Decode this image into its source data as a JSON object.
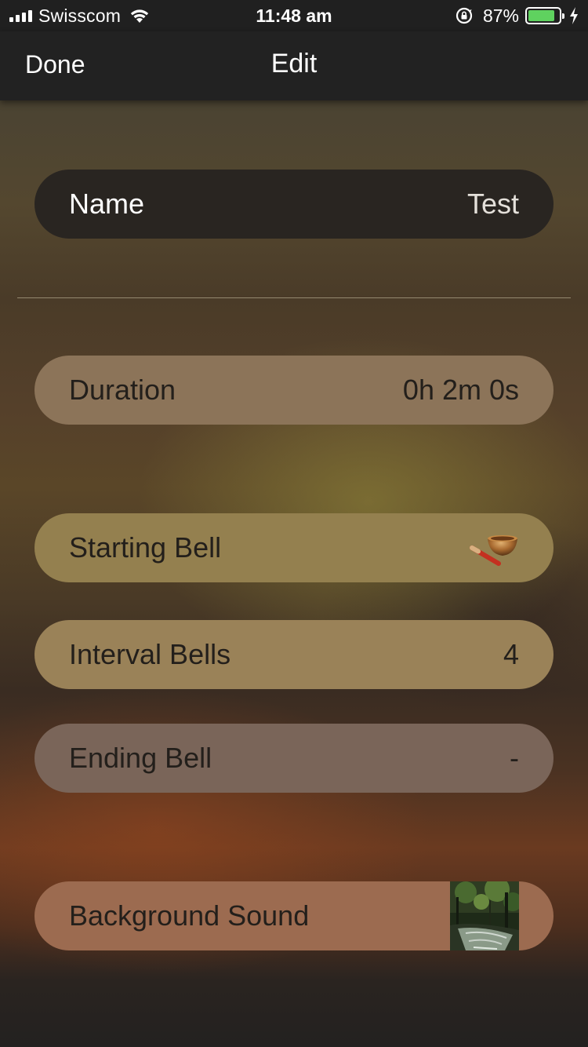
{
  "status_bar": {
    "carrier": "Swisscom",
    "time": "11:48 am",
    "battery_percent": "87%",
    "battery_level": 0.87,
    "battery_color": "#5fd25f",
    "icons": [
      "signal-icon",
      "wifi-icon",
      "rotation-lock-icon",
      "battery-icon",
      "charging-bolt-icon"
    ]
  },
  "nav": {
    "done_label": "Done",
    "title": "Edit"
  },
  "rows": {
    "name": {
      "label": "Name",
      "value": "Test"
    },
    "duration": {
      "label": "Duration",
      "value": "0h 2m 0s"
    },
    "starting_bell": {
      "label": "Starting Bell",
      "icon": "singing-bowl-icon"
    },
    "interval_bells": {
      "label": "Interval Bells",
      "value": "4"
    },
    "ending_bell": {
      "label": "Ending Bell",
      "value": "-"
    },
    "background_sound": {
      "label": "Background Sound",
      "thumbnail": "forest-stream-thumbnail"
    }
  }
}
